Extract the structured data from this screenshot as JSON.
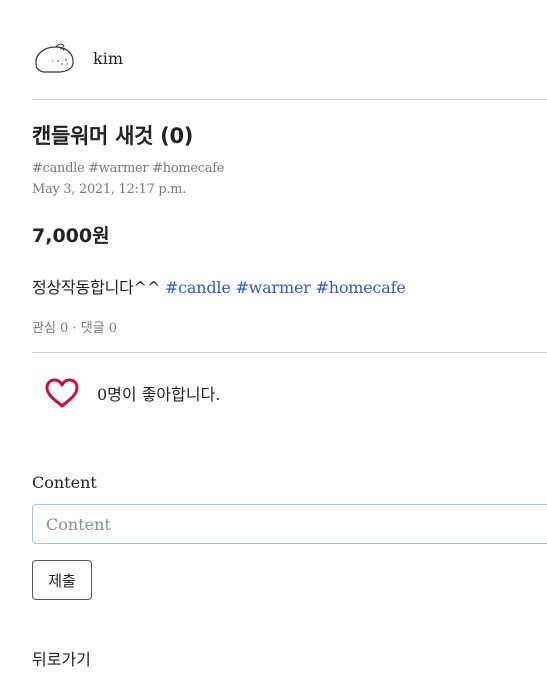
{
  "author": {
    "name": "kim",
    "avatar_icon": "dumpling-avatar-icon"
  },
  "post": {
    "title": "캔들워머 새것 (0)",
    "tags": "#candle #warmer #homecafe",
    "date": "May 3, 2021, 12:17 p.m.",
    "price": "7,000원",
    "description_text": "정상작동합니다^^ ",
    "description_hashtags": "#candle #warmer #homecafe",
    "counts": "관심 0 · 댓글 0"
  },
  "like": {
    "icon": "heart-icon",
    "color": "#c8103a",
    "text": "0명이 좋아합니다."
  },
  "comment_form": {
    "label": "Content",
    "placeholder": "Content",
    "value": "",
    "submit_label": "제출"
  },
  "back_link": "뒤로가기",
  "colors": {
    "hashtag": "#3a55c9",
    "muted": "#7a7a7a",
    "input_border": "#9ec5f0"
  }
}
